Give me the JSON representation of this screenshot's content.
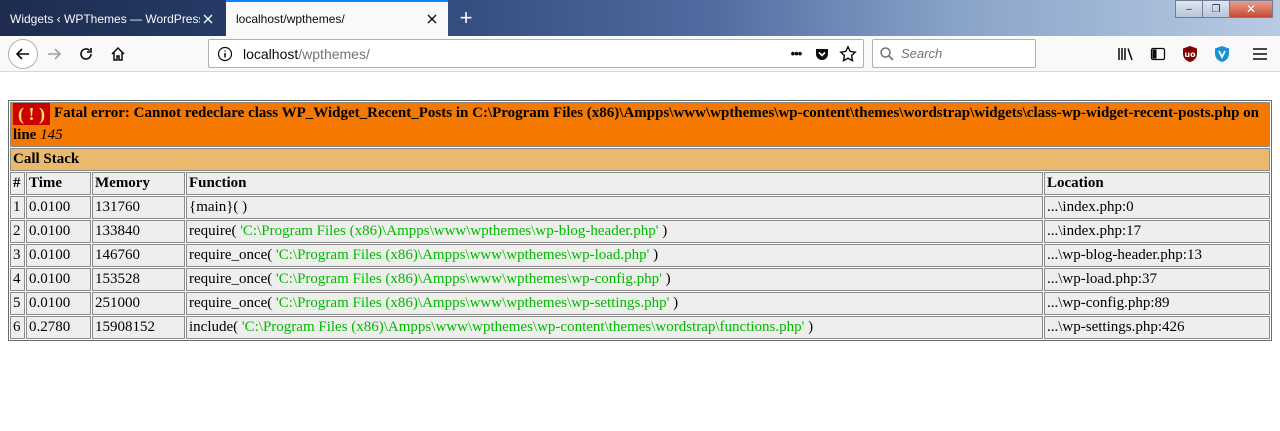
{
  "browser": {
    "tabs": [
      {
        "label": "Widgets ‹ WPThemes — WordPress",
        "active": false
      },
      {
        "label": "localhost/wpthemes/",
        "active": true
      }
    ],
    "new_tab_label": "+",
    "window_controls": {
      "minimize": "‒",
      "restore": "❐",
      "close": "✕"
    },
    "url": {
      "host": "localhost",
      "path": "/wpthemes/"
    },
    "page_actions": "•••",
    "search_placeholder": "Search"
  },
  "error": {
    "icon_text": "( ! )",
    "message": "Fatal error: Cannot redeclare class WP_Widget_Recent_Posts in C:\\Program Files (x86)\\Ampps\\www\\wpthemes\\wp-content\\themes\\wordstrap\\widgets\\class-wp-widget-recent-posts.php on line ",
    "line": "145"
  },
  "call_stack": {
    "title": "Call Stack",
    "headers": {
      "num": "#",
      "time": "Time",
      "memory": "Memory",
      "function": "Function",
      "location": "Location"
    },
    "rows": [
      {
        "num": "1",
        "time": "0.0100",
        "memory": "131760",
        "func": "{main}( )",
        "arg": "",
        "suffix": "",
        "location": "...\\index.php:0"
      },
      {
        "num": "2",
        "time": "0.0100",
        "memory": "133840",
        "func": "require( ",
        "arg": "'C:\\Program Files (x86)\\Ampps\\www\\wpthemes\\wp-blog-header.php'",
        "suffix": " )",
        "location": "...\\index.php:17"
      },
      {
        "num": "3",
        "time": "0.0100",
        "memory": "146760",
        "func": "require_once( ",
        "arg": "'C:\\Program Files (x86)\\Ampps\\www\\wpthemes\\wp-load.php'",
        "suffix": " )",
        "location": "...\\wp-blog-header.php:13"
      },
      {
        "num": "4",
        "time": "0.0100",
        "memory": "153528",
        "func": "require_once( ",
        "arg": "'C:\\Program Files (x86)\\Ampps\\www\\wpthemes\\wp-config.php'",
        "suffix": " )",
        "location": "...\\wp-load.php:37"
      },
      {
        "num": "5",
        "time": "0.0100",
        "memory": "251000",
        "func": "require_once( ",
        "arg": "'C:\\Program Files (x86)\\Ampps\\www\\wpthemes\\wp-settings.php'",
        "suffix": " )",
        "location": "...\\wp-config.php:89"
      },
      {
        "num": "6",
        "time": "0.2780",
        "memory": "15908152",
        "func": "include( ",
        "arg": "'C:\\Program Files (x86)\\Ampps\\www\\wpthemes\\wp-content\\themes\\wordstrap\\functions.php'",
        "suffix": " )",
        "location": "...\\wp-settings.php:426"
      }
    ]
  },
  "colors": {
    "error_bg": "#f57900",
    "icon_bg": "#cc0000",
    "icon_fg": "#fce94f",
    "callstack_bg": "#e9b96e",
    "row_bg": "#eeeeec",
    "string_color": "#00bb00"
  },
  "icons": [
    "close-icon",
    "plus-icon",
    "back-arrow-icon",
    "forward-arrow-icon",
    "reload-icon",
    "home-icon",
    "info-icon",
    "pocket-icon",
    "star-icon",
    "search-icon",
    "library-icon",
    "sidebar-icon",
    "ublock-icon",
    "shield-icon",
    "hamburger-menu-icon"
  ]
}
